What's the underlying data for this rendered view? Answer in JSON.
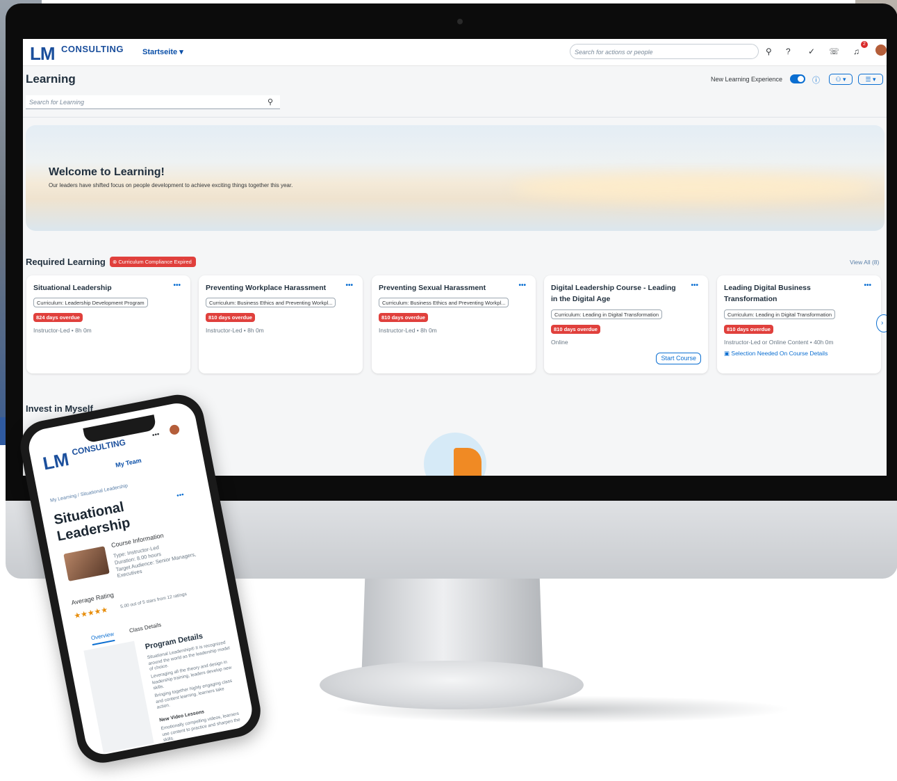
{
  "shell": {
    "logo_main": "LM",
    "logo_sub": "CONSULTING",
    "nav_menu": "Startseite ▾",
    "search_placeholder": "Search for actions or people",
    "notification_count": "2"
  },
  "learning": {
    "page_title": "Learning",
    "new_experience_label": "New Learning Experience",
    "search_placeholder": "Search for Learning",
    "hero_title": "Welcome to Learning!",
    "hero_subtitle": "Our leaders have shifted focus on people development to achieve exciting things together this year."
  },
  "required": {
    "title": "Required Learning",
    "badge": "Curriculum Compliance Expired",
    "view_all": "View All (8)",
    "cards": [
      {
        "title": "Situational Leadership",
        "tag": "Curriculum: Leadership Development Program",
        "overdue": "824 days overdue",
        "meta": "Instructor-Led • 8h 0m"
      },
      {
        "title": "Preventing Workplace Harassment",
        "tag": "Curriculum: Business Ethics and Preventing Workpl...",
        "overdue": "810 days overdue",
        "meta": "Instructor-Led • 8h 0m"
      },
      {
        "title": "Preventing Sexual Harassment",
        "tag": "Curriculum: Business Ethics and Preventing Workpl...",
        "overdue": "810 days overdue",
        "meta": "Instructor-Led • 8h 0m"
      },
      {
        "title": "Digital Leadership Course - Leading in the Digital Age",
        "tag": "Curriculum: Leading in Digital Transformation",
        "overdue": "810 days overdue",
        "meta": "Online",
        "action": "Start Course"
      },
      {
        "title": "Leading Digital Business Transformation",
        "tag": "Curriculum: Leading in Digital Transformation",
        "overdue": "810 days overdue",
        "meta": "Instructor-Led or Online Content • 40h 0m",
        "link": "Selection Needed On Course Details"
      }
    ]
  },
  "invest": {
    "title": "Invest in Myself"
  },
  "phone": {
    "logo_main": "LM",
    "logo_sub": "CONSULTING",
    "my_team": "My Team",
    "breadcrumb": "My Learning / Situational Leadership",
    "title": "Situational Leadership",
    "course_info_title": "Course Information",
    "type": "Type: Instructor-Led",
    "duration": "Duration: 8.00 hours",
    "audience": "Target Audience: Senior Managers, Executives",
    "rating_label": "Average Rating",
    "stars": "★★★★★",
    "rating_text": "5.00 out of 5 stars from 12 ratings",
    "tab_overview": "Overview",
    "tab_class": "Class Details",
    "program_details": "Program Details",
    "para1": "Situational Leadership® II is recognized around the world as the leadership model of choice.",
    "para2": "Leveraging all the theory and design in leadership training, leaders develop new skills.",
    "para3": "Bringing together highly engaging class and content learning, learners take action.",
    "new_video": "New Video Lessons",
    "para4": "Emotionally compelling videos, learners use content to practice and sharpen the skills."
  },
  "colors": {
    "brand": "#1b4f9c",
    "accent": "#0a6ed1",
    "overdue": "#e0403c"
  }
}
